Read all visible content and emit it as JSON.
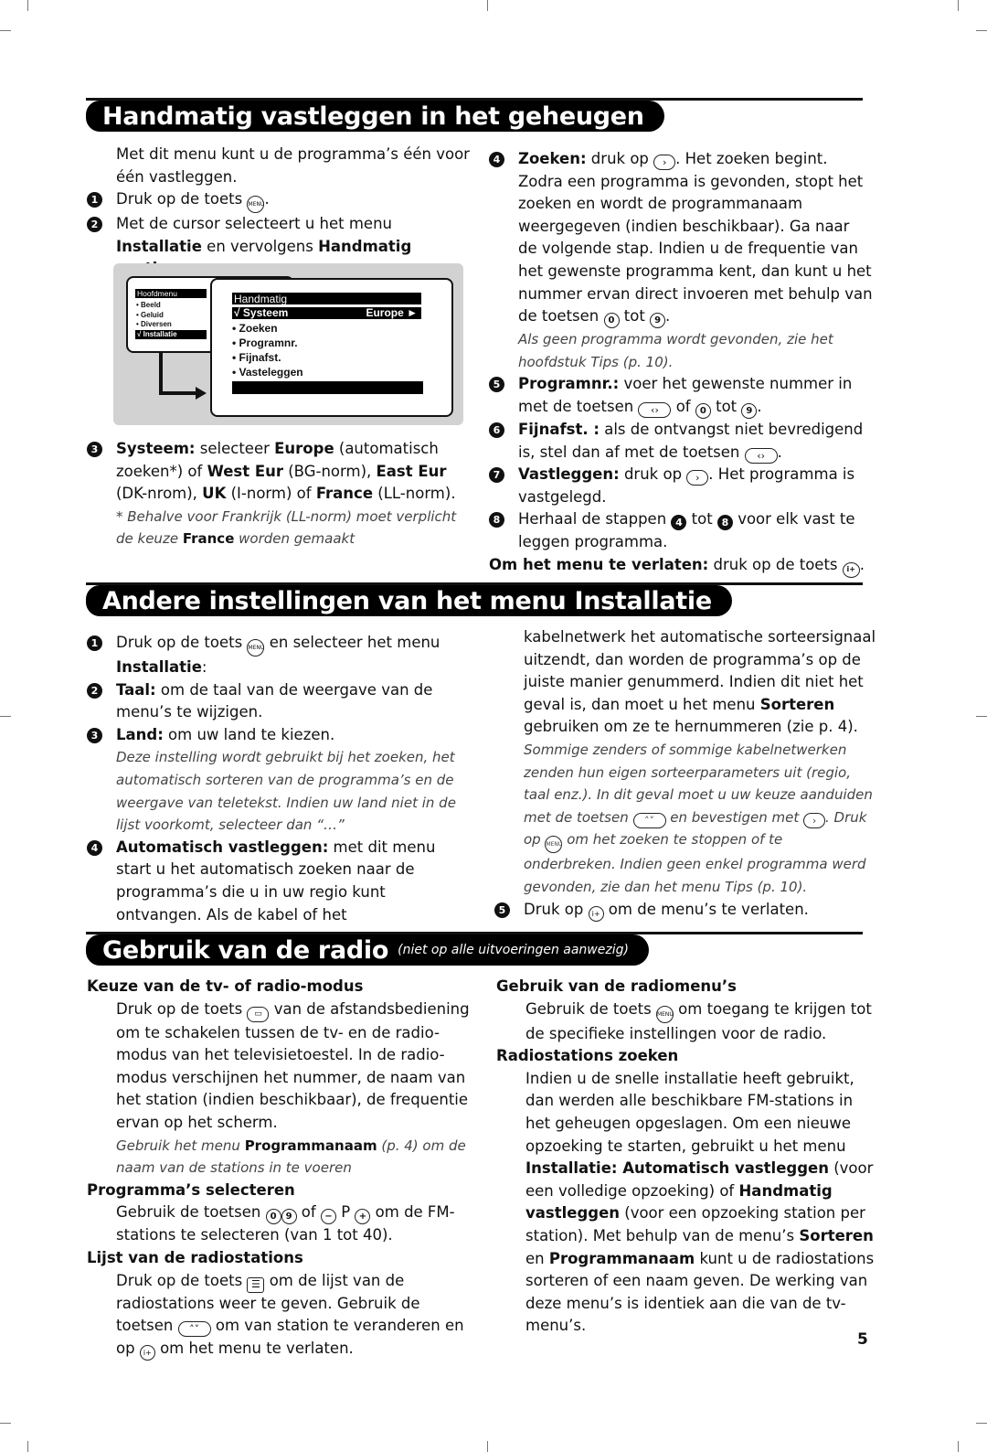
{
  "page_number": "5",
  "section1": {
    "title": "Handmatig vastleggen in het geheugen",
    "intro": "Met dit menu kunt u de programma’s één voor één vastleggen.",
    "steps": [
      {
        "n": "1",
        "pre": "Druk op de toets",
        "key": "MENU",
        "post": "."
      },
      {
        "n": "2",
        "pre": "Met de cursor selecteert u het menu ",
        "b1": "Installatie",
        "mid": " en vervolgens ",
        "b2": "Handmatig vastleggen",
        "post": ":"
      }
    ],
    "figure": {
      "main_menu": {
        "title": "Hoofdmenu",
        "items": [
          "• Beeld",
          "• Geluid",
          "• Diversen"
        ],
        "selected": "√ Installatie"
      },
      "sub_menu": {
        "title": "Handmatig",
        "selected_label": "√ Systeem",
        "selected_value": "Europe ►",
        "items": [
          "• Zoeken",
          "• Programnr.",
          "• Fijnafst.",
          "• Vasteleggen"
        ]
      }
    },
    "step3": {
      "n": "3",
      "b_systeem": "Systeem:",
      "t1": " selecteer ",
      "b_europe": "Europe",
      "t2": " (automatisch zoeken*) of ",
      "b_west": "West Eur",
      "t3": " (BG-norm), ",
      "b_east": "East Eur",
      "t4": " (DK-nrom), ",
      "b_uk": "UK",
      "t5": " (I-norm) of ",
      "b_france": "France",
      "t6": " (LL-norm).",
      "note_pre": "* Behalve voor Frankrijk (LL-norm) moet verplicht de keuze ",
      "note_b": "France",
      "note_post": " worden gemaakt"
    },
    "step4": {
      "n": "4",
      "b": "Zoeken:",
      "pre": " druk op ",
      "key": "›",
      "post": ". Het zoeken begint. Zodra een programma is gevonden, stopt het zoeken en wordt de programmanaam weergegeven (indien beschikbaar). Ga naar de volgende stap. Indien u de frequentie van het gewenste programma kent, dan kunt u het nummer ervan direct invoeren met behulp van de toetsen ",
      "k0": "0",
      "tot": " tot ",
      "k9": "9",
      "end": ".",
      "note": "Als geen programma wordt gevonden, zie het hoofdstuk Tips (p. 10)."
    },
    "step5": {
      "n": "5",
      "b": "Programnr.:",
      "pre": " voer het gewenste nummer in met de toetsen ",
      "keys": "‹›",
      "mid": " of ",
      "k0": "0",
      "tot": " tot ",
      "k9": "9",
      "end": "."
    },
    "step6": {
      "n": "6",
      "b": "Fijnafst. :",
      "pre": " als de ontvangst niet bevredigend is, stel dan af met de toetsen ",
      "keys": "‹›",
      "end": "."
    },
    "step7": {
      "n": "7",
      "b": "Vastleggen:",
      "pre": " druk op ",
      "key": "›",
      "post": ". Het programma is vastgelegd."
    },
    "step8": {
      "n": "8",
      "pre": "Herhaal de stappen ",
      "a": "4",
      "tot": " tot ",
      "b": "8",
      "post": " voor elk vast te leggen programma."
    },
    "exit": {
      "b": "Om het menu te verlaten:",
      "post": " druk op de toets ",
      "key": "i+",
      "end": "."
    }
  },
  "section2": {
    "title": "Andere instellingen van het menu Installatie",
    "step1": {
      "n": "1",
      "pre": "Druk op de toets ",
      "key": "MENU",
      "mid": " en selecteer het menu ",
      "b": "Installatie",
      "post": ":"
    },
    "step2": {
      "n": "2",
      "b": "Taal:",
      "post": " om de taal van de weergave van de menu’s te wijzigen."
    },
    "step3": {
      "n": "3",
      "b": "Land:",
      "post": " om uw land te kiezen.",
      "note": "Deze instelling wordt gebruikt bij het zoeken, het automatisch sorteren van de programma’s en de weergave van teletekst. Indien uw land niet in de lijst voorkomt, selecteer dan “…”"
    },
    "step4": {
      "n": "4",
      "b": "Automatisch vastleggen:",
      "post": " met dit menu start u het automatisch zoeken naar de programma’s die u in uw regio kunt ontvangen. Als de kabel of het"
    },
    "step4_cont": {
      "pre": "kabelnetwerk het automatische sorteersignaal uitzendt, dan worden de programma’s op de juiste manier genummerd. Indien dit niet het geval is, dan moet u het menu ",
      "b": "Sorteren",
      "post": " gebruiken om ze te hernummeren (zie p. 4)."
    },
    "step4_note": {
      "pre": "Sommige zenders of sommige kabelnetwerken zenden hun eigen sorteerparameters uit (regio, taal enz.). In dit geval moet u uw keuze aanduiden met de toetsen ",
      "keys": "˄˅",
      "mid": " en bevestigen met ",
      "key": "›",
      "mid2": ". Druk op ",
      "menu": "MENU",
      "post": " om het zoeken te stoppen of te onderbreken. Indien geen enkel programma werd gevonden, zie dan het menu Tips (p. 10)."
    },
    "step5": {
      "n": "5",
      "pre": "Druk op ",
      "key": "i+",
      "post": " om de menu’s te verlaten."
    }
  },
  "section3": {
    "title": "Gebruik van de radio",
    "subtitle": "(niet op alle uitvoeringen aanwezig)",
    "blocks_left": [
      {
        "heading": "Keuze van de tv- of radio-modus",
        "pre": "Druk op de toets ",
        "key": "▭",
        "post": " van de afstandsbediening om te schakelen tussen de tv- en de radio-modus van het televisietoestel. In de radio-modus verschijnen het nummer, de naam van het station (indien beschikbaar), de frequentie ervan op het scherm.",
        "note_pre": "Gebruik het menu ",
        "note_b": "Programmanaam",
        "note_post": " (p. 4) om de naam van de stations in te voeren"
      },
      {
        "heading": "Programma’s selecteren",
        "pre": "Gebruik de toetsen ",
        "k0": "0",
        "k9": "9",
        "mid": " of ",
        "minus": "−",
        "p": " P ",
        "plus": "+",
        "post": " om de FM-stations te selecteren (van 1 tot 40)."
      },
      {
        "heading": "Lijst van de radiostations",
        "pre": "Druk op de toets ",
        "key": "☰",
        "mid": " om de lijst van de radiostations weer te geven. Gebruik de toetsen ",
        "keys": "˄˅",
        "mid2": " om van station te veranderen en op ",
        "key2": "i+",
        "post": " om het menu te verlaten."
      }
    ],
    "blocks_right": [
      {
        "heading": "Gebruik van de radiomenu’s",
        "pre": "Gebruik de toets ",
        "key": "MENU",
        "post": " om toegang te krijgen tot de specifieke instellingen voor de radio."
      },
      {
        "heading": "Radiostations zoeken",
        "t1": "Indien u de snelle installatie heeft gebruikt, dan werden alle beschikbare FM-stations in het geheugen opgeslagen. Om een nieuwe opzoeking te starten, gebruikt u het menu ",
        "b1": "Installatie: Automatisch vastleggen",
        "t2": " (voor een volledige opzoeking) of ",
        "b2": "Handmatig vastleggen",
        "t3": " (voor een opzoeking station per station). Met behulp van de menu’s ",
        "b3": "Sorteren",
        "t4": " en ",
        "b4": "Programmanaam",
        "t5": " kunt u de radiostations sorteren of een naam geven. De werking van deze menu’s is identiek aan die van de tv-menu’s."
      }
    ]
  }
}
